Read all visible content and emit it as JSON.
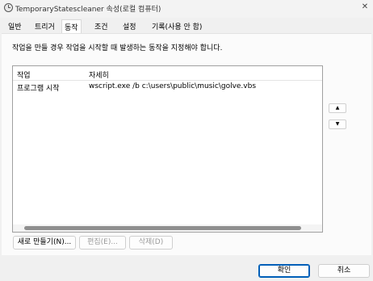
{
  "window": {
    "title": "TemporaryStatescleaner 속성(로컬 컴퓨터)",
    "close_glyph": "✕"
  },
  "tabs": [
    {
      "label": "일반",
      "active": false
    },
    {
      "label": "트리거",
      "active": false
    },
    {
      "label": "동작",
      "active": true
    },
    {
      "label": "조건",
      "active": false
    },
    {
      "label": "설정",
      "active": false
    },
    {
      "label": "기록(사용 안 함)",
      "active": false
    }
  ],
  "actions_panel": {
    "description": "작업을 만들 경우 작업을 시작할 때 발생하는 동작을 지정해야 합니다.",
    "columns": [
      "작업",
      "자세히"
    ],
    "rows": [
      {
        "action": "프로그램 시작",
        "details": "wscript.exe /b c:\\users\\public\\music\\golve.vbs"
      }
    ],
    "move_up_glyph": "▲",
    "move_down_glyph": "▼",
    "new_button": "새로 만들기(N)...",
    "edit_button": "편집(E)...",
    "delete_button": "삭제(D)"
  },
  "footer": {
    "ok_button": "확인",
    "cancel_button": "취소"
  },
  "colors": {
    "window_bg": "#f0f0f0",
    "primary_border": "#005fb8"
  }
}
